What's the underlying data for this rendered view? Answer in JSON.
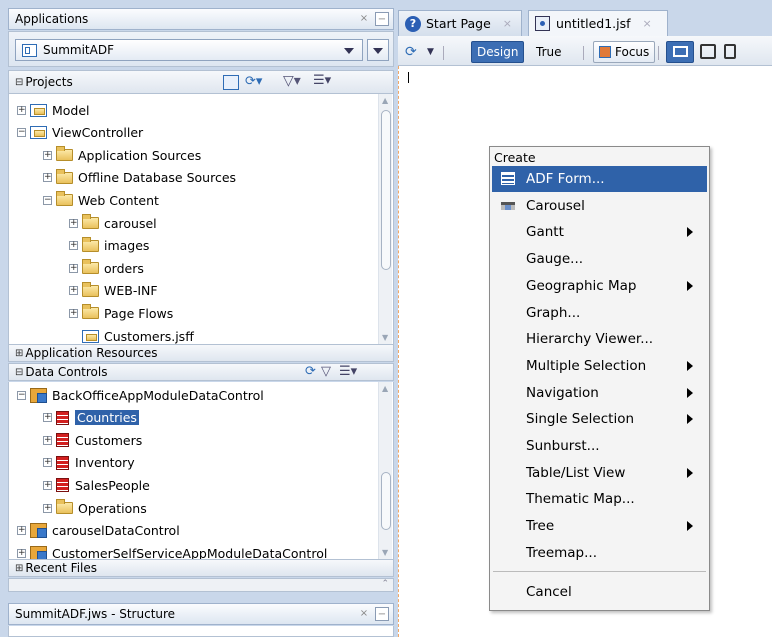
{
  "left": {
    "applications_title": "Applications",
    "app_select": "SummitADF",
    "projects_label": "Projects",
    "projects_tree": [
      {
        "label": "Model",
        "type": "project",
        "depth": 0,
        "expander": "+"
      },
      {
        "label": "ViewController",
        "type": "project",
        "depth": 0,
        "expander": "−"
      },
      {
        "label": "Application Sources",
        "type": "folder",
        "depth": 1,
        "expander": "+"
      },
      {
        "label": "Offline Database Sources",
        "type": "folder",
        "depth": 1,
        "expander": "+"
      },
      {
        "label": "Web Content",
        "type": "folder",
        "depth": 1,
        "expander": "−"
      },
      {
        "label": "carousel",
        "type": "folder",
        "depth": 2,
        "expander": "+"
      },
      {
        "label": "images",
        "type": "folder",
        "depth": 2,
        "expander": "+"
      },
      {
        "label": "orders",
        "type": "folder",
        "depth": 2,
        "expander": "+"
      },
      {
        "label": "WEB-INF",
        "type": "folder",
        "depth": 2,
        "expander": "+"
      },
      {
        "label": "Page Flows",
        "type": "folder",
        "depth": 2,
        "expander": "+"
      },
      {
        "label": "Customers.jsff",
        "type": "file",
        "depth": 2,
        "expander": ""
      }
    ],
    "app_resources_label": "Application Resources",
    "data_controls_label": "Data Controls",
    "data_tree": [
      {
        "label": "BackOfficeAppModuleDataControl",
        "type": "dc",
        "depth": 0,
        "expander": "−"
      },
      {
        "label": "Countries",
        "type": "collection",
        "depth": 1,
        "expander": "+",
        "selected": true
      },
      {
        "label": "Customers",
        "type": "collection",
        "depth": 1,
        "expander": "+"
      },
      {
        "label": "Inventory",
        "type": "collection",
        "depth": 1,
        "expander": "+"
      },
      {
        "label": "SalesPeople",
        "type": "collection",
        "depth": 1,
        "expander": "+"
      },
      {
        "label": "Operations",
        "type": "folder",
        "depth": 1,
        "expander": "+"
      },
      {
        "label": "carouselDataControl",
        "type": "dc",
        "depth": 0,
        "expander": "+"
      },
      {
        "label": "CustomerSelfServiceAppModuleDataControl",
        "type": "dc",
        "depth": 0,
        "expander": "+"
      }
    ],
    "recent_files_label": "Recent Files",
    "structure_title": "SummitADF.jws - Structure"
  },
  "editor": {
    "tabs": [
      {
        "label": "Start Page",
        "active": false
      },
      {
        "label": "untitled1.jsf",
        "active": true
      }
    ],
    "toolbar": {
      "design": "Design",
      "true_label": "True",
      "focus": "Focus"
    }
  },
  "context_menu": {
    "header": "Create",
    "items": [
      {
        "label": "ADF Form...",
        "icon": "form-icon",
        "highlighted": true,
        "submenu": false
      },
      {
        "label": "Carousel",
        "icon": "carousel-icon",
        "submenu": false
      },
      {
        "label": "Gantt",
        "submenu": true
      },
      {
        "label": "Gauge...",
        "submenu": false
      },
      {
        "label": "Geographic Map",
        "submenu": true
      },
      {
        "label": "Graph...",
        "submenu": false
      },
      {
        "label": "Hierarchy Viewer...",
        "submenu": false
      },
      {
        "label": "Multiple Selection",
        "submenu": true
      },
      {
        "label": "Navigation",
        "submenu": true
      },
      {
        "label": "Single Selection",
        "submenu": true
      },
      {
        "label": "Sunburst...",
        "submenu": false
      },
      {
        "label": "Table/List View",
        "submenu": true
      },
      {
        "label": "Thematic Map...",
        "submenu": false
      },
      {
        "label": "Tree",
        "submenu": true
      },
      {
        "label": "Treemap...",
        "submenu": false
      }
    ],
    "cancel": "Cancel"
  },
  "colors": {
    "selection": "#2f62a9",
    "panel_bg": "#c9d7ea"
  }
}
